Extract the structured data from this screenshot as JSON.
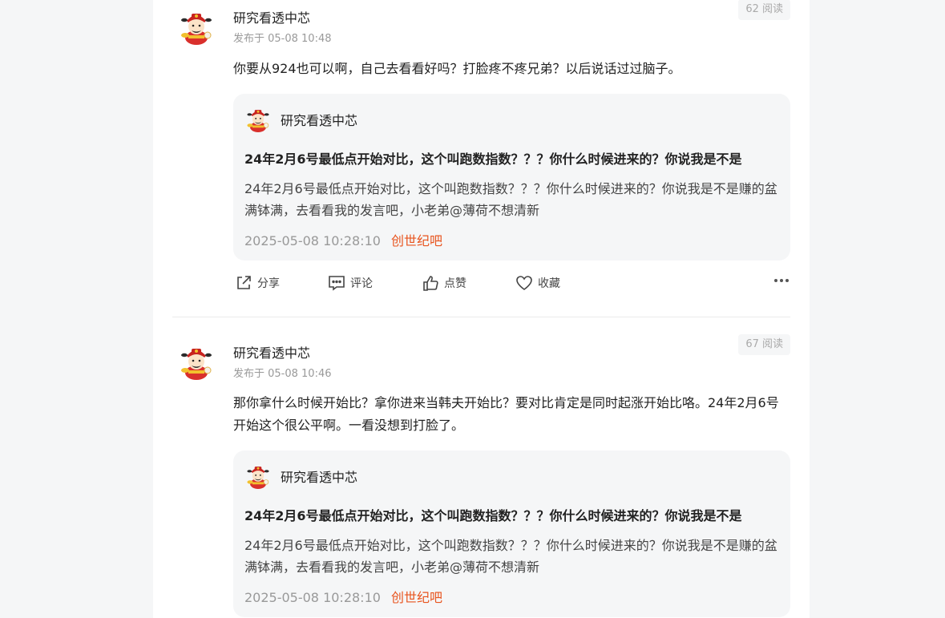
{
  "posts": [
    {
      "author": "研究看透中芯",
      "published": "发布于 05-08 10:48",
      "reads": "62 阅读",
      "text": "你要从924也可以啊，自己去看看好吗？打脸疼不疼兄弟？以后说话过过脑子。",
      "quote": {
        "author": "研究看透中芯",
        "title": "24年2月6号最低点开始对比，这个叫跑数指数？？？你什么时候进来的？你说我是不是",
        "body": "24年2月6号最低点开始对比，这个叫跑数指数？？？你什么时候进来的？你说我是不是赚的盆满钵满，去看看我的发言吧，小老弟@薄荷不想清新",
        "date": "2025-05-08 10:28:10",
        "tag": "创世纪吧"
      },
      "actions": {
        "share": "分享",
        "comment": "评论",
        "like": "点赞",
        "favorite": "收藏"
      }
    },
    {
      "author": "研究看透中芯",
      "published": "发布于 05-08 10:46",
      "reads": "67 阅读",
      "text": "那你拿什么时候开始比？拿你进来当韩夫开始比？要对比肯定是同时起涨开始比咯。24年2月6号开始这个很公平啊。一看没想到打脸了。",
      "quote": {
        "author": "研究看透中芯",
        "title": "24年2月6号最低点开始对比，这个叫跑数指数？？？你什么时候进来的？你说我是不是",
        "body": "24年2月6号最低点开始对比，这个叫跑数指数？？？你什么时候进来的？你说我是不是赚的盆满钵满，去看看我的发言吧，小老弟@薄荷不想清新",
        "date": "2025-05-08 10:28:10",
        "tag": "创世纪吧"
      }
    }
  ],
  "icons": [
    "god-of-wealth-avatar-icon",
    "share-icon",
    "comment-icon",
    "like-icon",
    "heart-icon",
    "more-icon"
  ],
  "colors": {
    "accent_tag": "#e8541e",
    "quote_bg": "#f5f6f7",
    "page_bg": "#f5f6f7"
  }
}
